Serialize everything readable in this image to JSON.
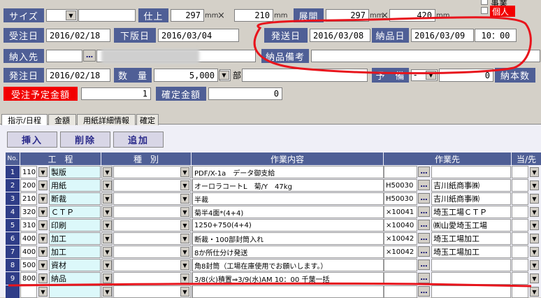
{
  "top": {
    "size_label": "サイズ",
    "finish_label": "仕上",
    "finish_w": "297",
    "finish_h": "210",
    "unit_mm": "mm",
    "times": "×",
    "open_label": "展開",
    "open_w": "297",
    "open_h": "420",
    "business_label": "事業",
    "individual_label": "個人"
  },
  "dates": {
    "order_date_label": "受注日",
    "order_date": "2016/02/18",
    "release_date_label": "下版日",
    "release_date": "2016/03/04",
    "ship_date_label": "発送日",
    "ship_date": "2016/03/08",
    "delivery_date_label": "納品日",
    "delivery_date": "2016/03/09",
    "delivery_time": "10：00"
  },
  "delivery": {
    "dest_label": "納入先",
    "ellipsis": "…",
    "remark_label": "納品備考"
  },
  "order": {
    "issue_date_label": "発注日",
    "issue_date": "2016/02/18",
    "qty_label": "数　量",
    "qty": "5,000",
    "qty_unit": "部",
    "spare_label": "予　備",
    "spare_sign": "-",
    "spare_value": "0",
    "delivery_count_label": "納本数"
  },
  "amount": {
    "planned_label": "受注予定金額",
    "planned_value": "1",
    "confirmed_label": "確定金額",
    "confirmed_value": "0"
  },
  "tabs": [
    "指示/日程",
    "金額",
    "用紙詳細情報",
    "確定"
  ],
  "toolbar": {
    "insert": "挿入",
    "delete": "削除",
    "add": "追加"
  },
  "grid": {
    "headers": {
      "no": "No.",
      "process": "工　程",
      "type": "種　別",
      "content": "作業内容",
      "vendor": "作業先",
      "owner": "当/先"
    },
    "rows": [
      {
        "no": "1",
        "code": "110",
        "process": "製版",
        "content": "PDF/X-1a　データ御支給",
        "vcode": "",
        "vendor": ""
      },
      {
        "no": "2",
        "code": "200",
        "process": "用紙",
        "content": "オーロラコートL　菊/Y　47kg",
        "vcode": "H50030",
        "vendor": "吉川紙商事㈱"
      },
      {
        "no": "3",
        "code": "210",
        "process": "断裁",
        "content": "半裁",
        "vcode": "H50030",
        "vendor": "吉川紙商事㈱"
      },
      {
        "no": "4",
        "code": "320",
        "process": "ＣＴＰ",
        "content": "菊半4面*(4+4)",
        "vcode": "×10041",
        "vendor": "埼玉工場ＣＴＰ"
      },
      {
        "no": "5",
        "code": "310",
        "process": "印刷",
        "content": "1250+750(4+4)",
        "vcode": "×10040",
        "vendor": "㈱山愛埼玉工場"
      },
      {
        "no": "6",
        "code": "400",
        "process": "加工",
        "content": "断裁・100部封筒入れ",
        "vcode": "×10042",
        "vendor": "埼玉工場加工"
      },
      {
        "no": "7",
        "code": "400",
        "process": "加工",
        "content": "8か所仕分け発送",
        "vcode": "×10042",
        "vendor": "埼玉工場加工"
      },
      {
        "no": "8",
        "code": "500",
        "process": "資材",
        "content": "角8封筒（工場在庫使用でお願いします。）",
        "vcode": "",
        "vendor": ""
      },
      {
        "no": "9",
        "code": "800",
        "process": "納品",
        "content": "3/8(火)積置⇒3/9(水)AM 10：00 千葉一括",
        "vcode": "",
        "vendor": ""
      },
      {
        "no": "",
        "code": "",
        "process": "",
        "content": "",
        "vcode": "",
        "vendor": ""
      }
    ]
  },
  "colors": {
    "label_bg": "#4f5f96",
    "row_no_bg": "#2f3d88",
    "annotation": "#e8141c",
    "alert": "#f20000"
  }
}
